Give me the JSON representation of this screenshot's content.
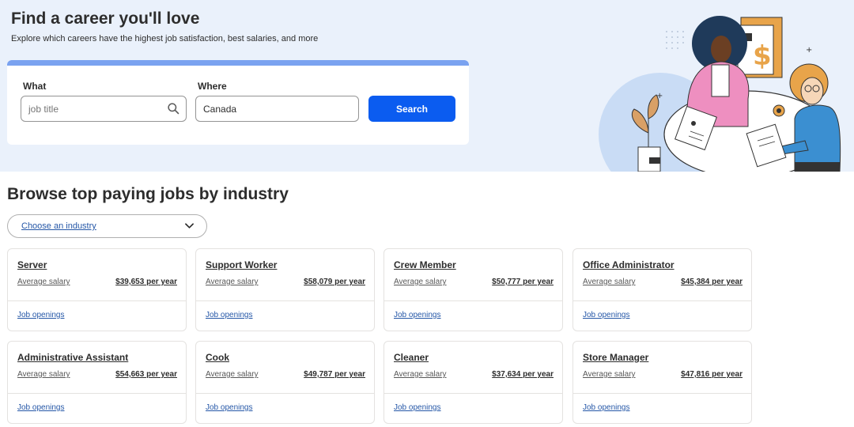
{
  "hero": {
    "title": "Find a career you'll love",
    "subtitle": "Explore which careers have the highest job satisfaction, best salaries, and more"
  },
  "search": {
    "what_label": "What",
    "what_placeholder": "job title",
    "where_label": "Where",
    "where_value": "Canada",
    "button_label": "Search",
    "icon": "search-icon"
  },
  "browse": {
    "title": "Browse top paying jobs by industry",
    "industry_select_label": "Choose an industry",
    "chevron_icon": "chevron-down-icon"
  },
  "jobs": [
    {
      "title": "Server",
      "salary_label": "Average salary",
      "salary": "$39,653 per year",
      "link": "Job openings"
    },
    {
      "title": "Support Worker",
      "salary_label": "Average salary",
      "salary": "$58,079 per year",
      "link": "Job openings"
    },
    {
      "title": "Crew Member",
      "salary_label": "Average salary",
      "salary": "$50,777 per year",
      "link": "Job openings"
    },
    {
      "title": "Office Administrator",
      "salary_label": "Average salary",
      "salary": "$45,384 per year",
      "link": "Job openings"
    },
    {
      "title": "Administrative Assistant",
      "salary_label": "Average salary",
      "salary": "$54,663 per year",
      "link": "Job openings"
    },
    {
      "title": "Cook",
      "salary_label": "Average salary",
      "salary": "$49,787 per year",
      "link": "Job openings"
    },
    {
      "title": "Cleaner",
      "salary_label": "Average salary",
      "salary": "$37,634 per year",
      "link": "Job openings"
    },
    {
      "title": "Store Manager",
      "salary_label": "Average salary",
      "salary": "$47,816 per year",
      "link": "Job openings"
    }
  ],
  "colors": {
    "hero_bg": "#eaf1fb",
    "primary_button": "#0b5cf0",
    "link": "#2557a7",
    "text": "#2d2d2d"
  }
}
